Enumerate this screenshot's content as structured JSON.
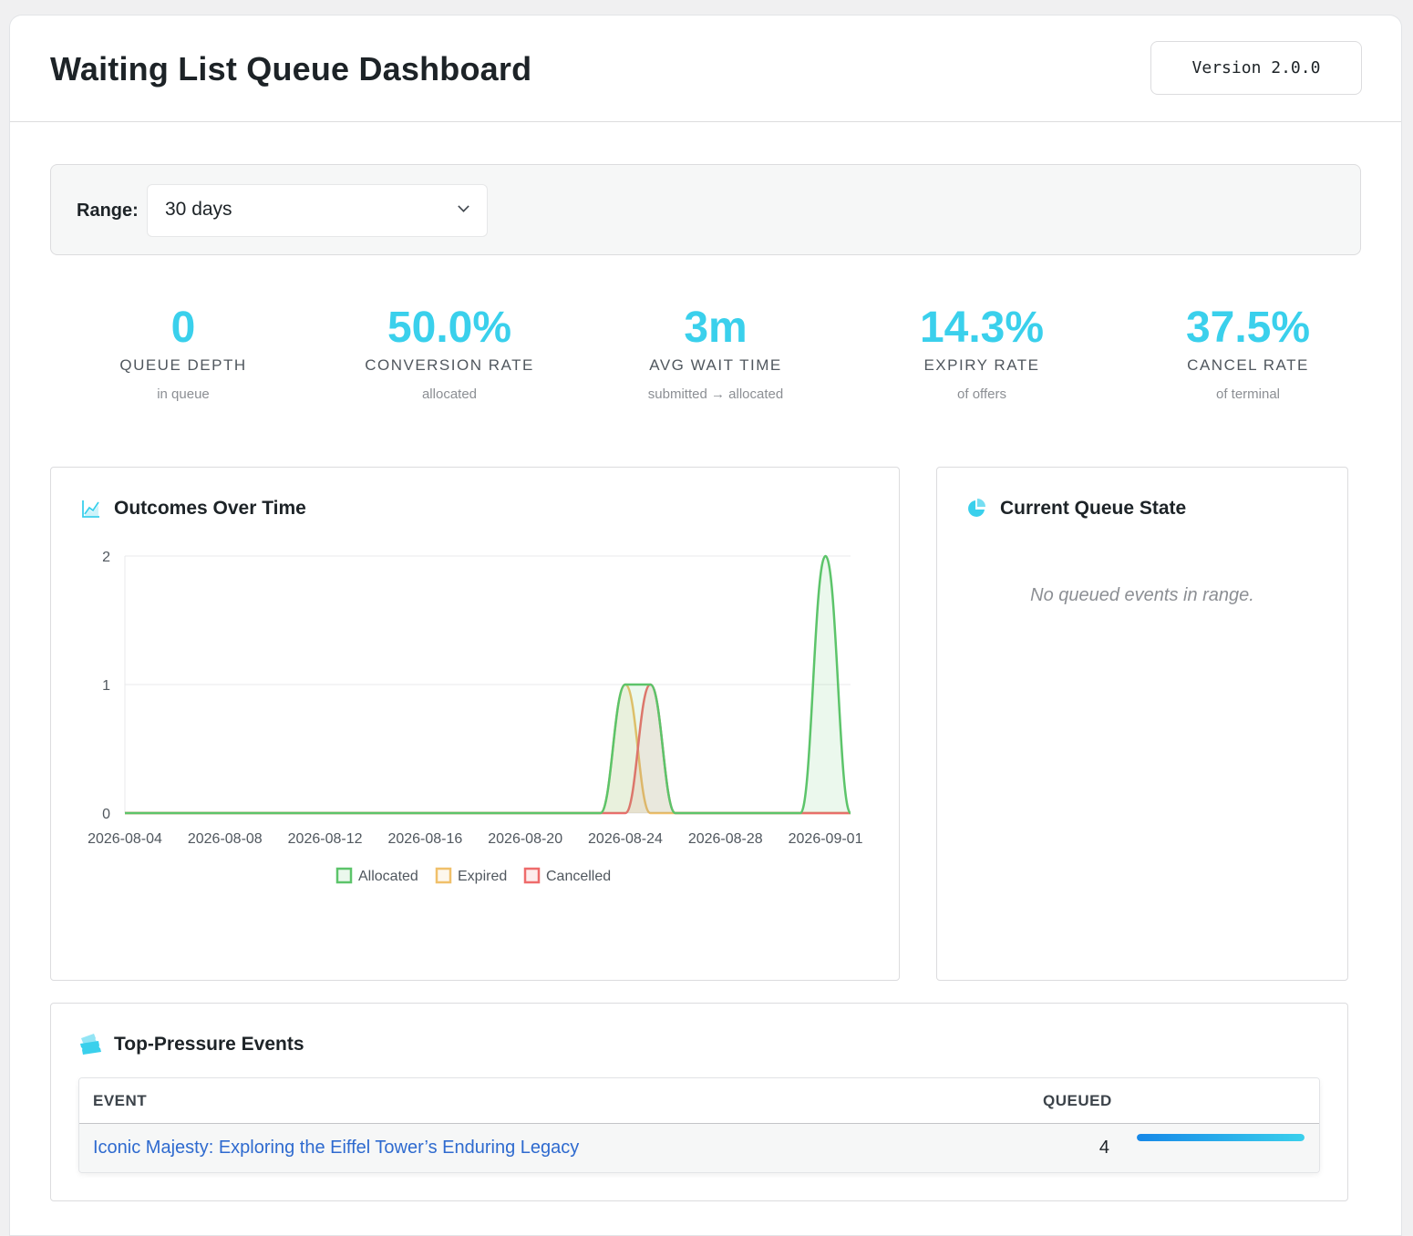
{
  "header": {
    "title": "Waiting List Queue Dashboard",
    "version": "Version 2.0.0"
  },
  "filter": {
    "range_label": "Range:",
    "range_value": "30 days"
  },
  "kpis": [
    {
      "value": "0",
      "label": "QUEUE DEPTH",
      "sub": "in queue"
    },
    {
      "value": "50.0%",
      "label": "CONVERSION RATE",
      "sub": "allocated"
    },
    {
      "value": "3m",
      "label": "AVG WAIT TIME",
      "sub": "submitted → allocated"
    },
    {
      "value": "14.3%",
      "label": "EXPIRY RATE",
      "sub": "of offers"
    },
    {
      "value": "37.5%",
      "label": "CANCEL RATE",
      "sub": "of terminal"
    }
  ],
  "outcomes_card": {
    "title": "Outcomes Over Time",
    "icon": "chart-line-icon"
  },
  "queue_state_card": {
    "title": "Current Queue State",
    "icon": "pie-chart-icon",
    "empty_message": "No queued events in range."
  },
  "pressure_card": {
    "title": "Top-Pressure Events",
    "icon": "tickets-icon",
    "columns": [
      "EVENT",
      "QUEUED"
    ],
    "rows": [
      {
        "event": "Iconic Majesty: Exploring the Eiffel Tower’s Enduring Legacy",
        "queued": "4",
        "fill": 1.0
      }
    ]
  },
  "colors": {
    "accent": "#3ad0ec",
    "allocated": "#5cc46a",
    "expired": "#f0c06a",
    "cancelled": "#ee6b6b"
  },
  "chart_data": {
    "type": "line",
    "x": [
      "2026-08-04",
      "2026-08-05",
      "2026-08-06",
      "2026-08-07",
      "2026-08-08",
      "2026-08-09",
      "2026-08-10",
      "2026-08-11",
      "2026-08-12",
      "2026-08-13",
      "2026-08-14",
      "2026-08-15",
      "2026-08-16",
      "2026-08-17",
      "2026-08-18",
      "2026-08-19",
      "2026-08-20",
      "2026-08-21",
      "2026-08-22",
      "2026-08-23",
      "2026-08-24",
      "2026-08-25",
      "2026-08-26",
      "2026-08-27",
      "2026-08-28",
      "2026-08-29",
      "2026-08-30",
      "2026-08-31",
      "2026-09-01",
      "2026-09-02"
    ],
    "x_tick_labels": [
      "2026-08-04",
      "2026-08-08",
      "2026-08-12",
      "2026-08-16",
      "2026-08-20",
      "2026-08-24",
      "2026-08-28",
      "2026-09-01"
    ],
    "series": [
      {
        "name": "Allocated",
        "values": [
          0,
          0,
          0,
          0,
          0,
          0,
          0,
          0,
          0,
          0,
          0,
          0,
          0,
          0,
          0,
          0,
          0,
          0,
          0,
          0,
          1,
          1,
          0,
          0,
          0,
          0,
          0,
          0,
          2,
          0
        ]
      },
      {
        "name": "Expired",
        "values": [
          0,
          0,
          0,
          0,
          0,
          0,
          0,
          0,
          0,
          0,
          0,
          0,
          0,
          0,
          0,
          0,
          0,
          0,
          0,
          0,
          1,
          0,
          0,
          0,
          0,
          0,
          0,
          0,
          0,
          0
        ]
      },
      {
        "name": "Cancelled",
        "values": [
          0,
          0,
          0,
          0,
          0,
          0,
          0,
          0,
          0,
          0,
          0,
          0,
          0,
          0,
          0,
          0,
          0,
          0,
          0,
          0,
          0,
          1,
          0,
          0,
          0,
          0,
          0,
          0,
          0,
          0
        ]
      }
    ],
    "ylim": [
      0,
      2
    ],
    "y_ticks": [
      0,
      1,
      2
    ],
    "legend": "bottom",
    "grid": true
  }
}
